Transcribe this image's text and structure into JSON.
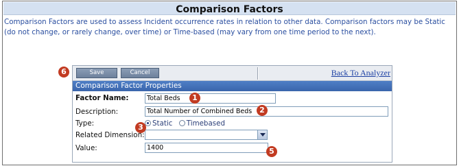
{
  "page": {
    "title": "Comparison Factors",
    "description": "Comparison Factors are used to assess Incident occurrence rates in relation to other data. Comparison factors may be Static (do not change, or rarely change, over time) or Time-based (may vary from one time period to the next)."
  },
  "toolbar": {
    "save_label": "Save",
    "cancel_label": "Cancel",
    "back_link": "Back To Analyzer"
  },
  "form": {
    "section_title": "Comparison Factor Properties",
    "factor_name_label": "Factor Name:",
    "factor_name_value": "Total Beds",
    "description_label": "Description:",
    "description_value": "Total Number of Combined Beds",
    "type_label": "Type:",
    "type_options": [
      "Static",
      "Timebased"
    ],
    "type_selected": "Static",
    "related_dimension_label": "Related Dimension:",
    "related_dimension_value": "",
    "value_label": "Value:",
    "value_value": "1400"
  },
  "annotations": [
    "1",
    "2",
    "3",
    "5",
    "6"
  ],
  "colors": {
    "header_bg": "#d5e1f1",
    "section_header": "#3a65ac",
    "badge": "#c23b22",
    "link": "#1b3fa3",
    "description_text": "#2b4fa0"
  }
}
